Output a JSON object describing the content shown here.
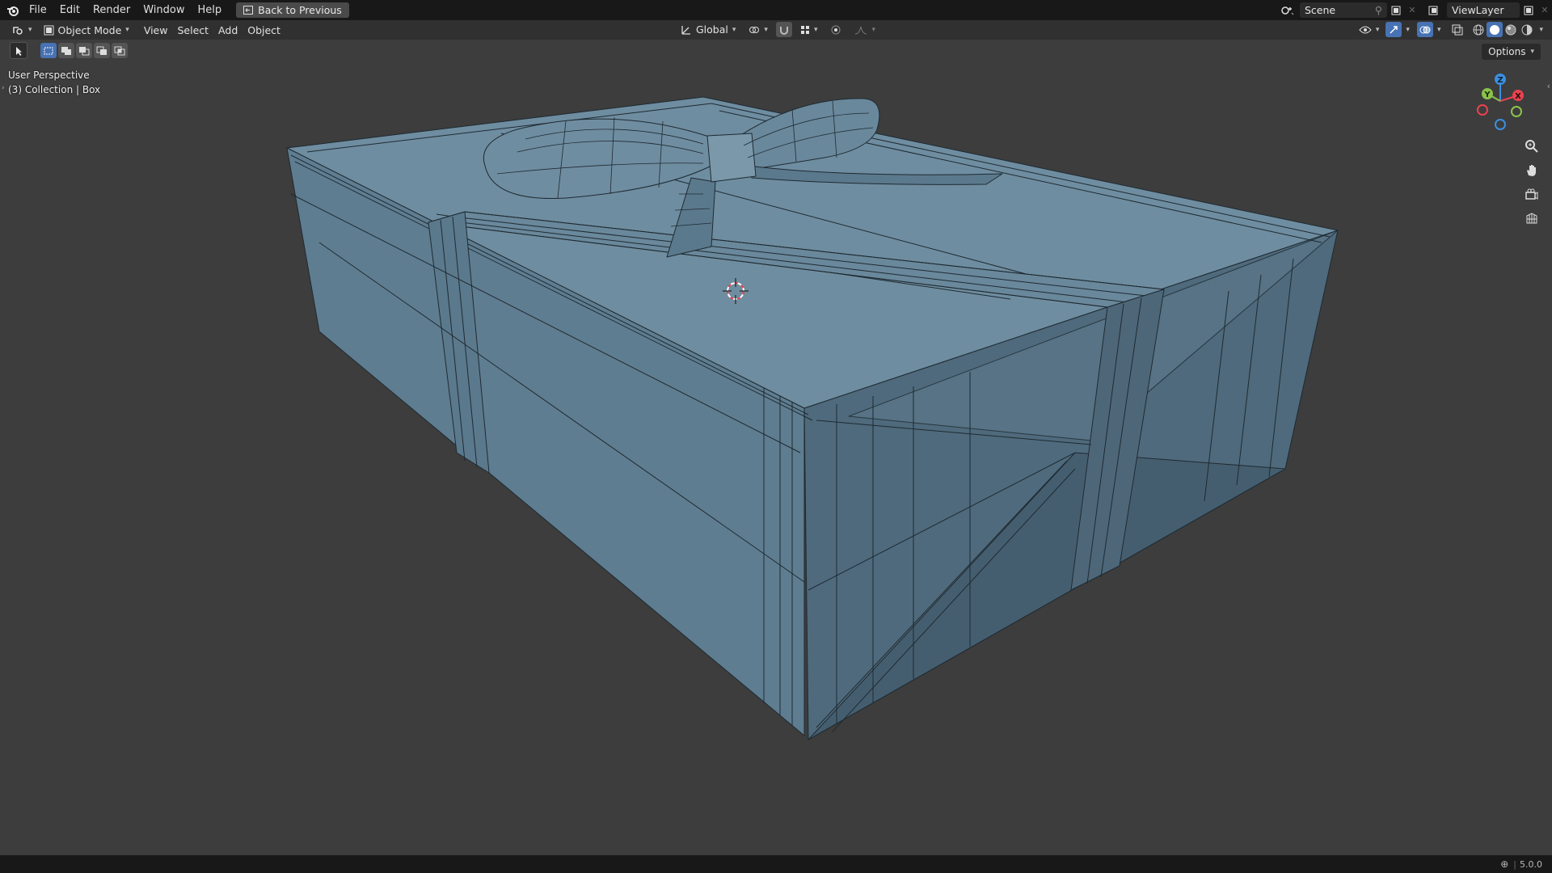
{
  "topbar": {
    "menus": [
      "File",
      "Edit",
      "Render",
      "Window",
      "Help"
    ],
    "back_label": "Back to Previous",
    "scene_name": "Scene",
    "view_layer": "ViewLayer"
  },
  "header": {
    "mode": "Object Mode",
    "menus": [
      "View",
      "Select",
      "Add",
      "Object"
    ],
    "transform_orientation": "Global",
    "options_label": "Options"
  },
  "viewport": {
    "perspective_label": "User Perspective",
    "collection_label": "(3) Collection | Box",
    "gizmo": {
      "x": "X",
      "y": "Y",
      "z": "Z"
    }
  },
  "status": {
    "version": "5.0.0"
  },
  "colors": {
    "accent": "#4772b3",
    "mesh_top": "#6f8da0",
    "mesh_side": "#5d7b8e",
    "mesh_dark": "#4a6374",
    "gizmo_x": "#e8434f",
    "gizmo_y": "#8bc34a",
    "gizmo_z": "#3a8fe3"
  }
}
